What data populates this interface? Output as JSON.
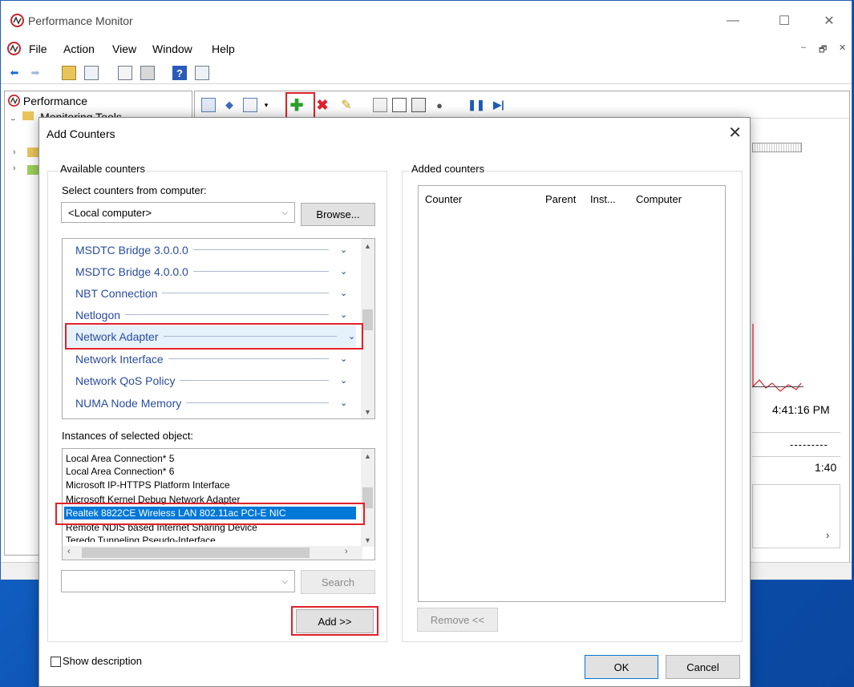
{
  "window": {
    "title": "Performance Monitor",
    "minimize": "—",
    "maximize": "☐",
    "close": "✕"
  },
  "menu": {
    "items": [
      "File",
      "Action",
      "View",
      "Window",
      "Help"
    ],
    "mdi_min": "–",
    "mdi_restore": "🗗",
    "mdi_close": "✕"
  },
  "tree": {
    "root": "Performance",
    "child": "Monitoring Tools"
  },
  "graph": {
    "time": "4:41:16 PM",
    "dashes": "---------",
    "duration": "1:40",
    "scroll_right": "›"
  },
  "dialog": {
    "title": "Add Counters",
    "close": "✕",
    "available_label": "Available counters",
    "select_from_label": "Select counters from computer:",
    "computer_value": "<Local computer>",
    "browse_label": "Browse...",
    "objects": [
      "MSDTC Bridge 3.0.0.0",
      "MSDTC Bridge 4.0.0.0",
      "NBT Connection",
      "Netlogon",
      "Network Adapter",
      "Network Interface",
      "Network QoS Policy",
      "NUMA Node Memory"
    ],
    "instances_label": "Instances of selected object:",
    "instances": [
      "Local Area Connection* 5",
      "Local Area Connection* 6",
      "Microsoft IP-HTTPS Platform Interface",
      "Microsoft Kernel Debug Network Adapter",
      "Realtek 8822CE Wireless LAN 802.11ac PCI-E NIC",
      "Remote NDIS based Internet Sharing Device",
      "Teredo Tunneling Pseudo-Interface"
    ],
    "search_label": "Search",
    "add_label": "Add >>",
    "added_label": "Added counters",
    "columns": [
      "Counter",
      "Parent",
      "Inst...",
      "Computer"
    ],
    "remove_label": "Remove <<",
    "show_description_label": "Show description",
    "ok_label": "OK",
    "cancel_label": "Cancel"
  },
  "colors": {
    "highlight_box": "#e0212b",
    "selection": "#0078d7",
    "object_text": "#2a4c9b"
  }
}
